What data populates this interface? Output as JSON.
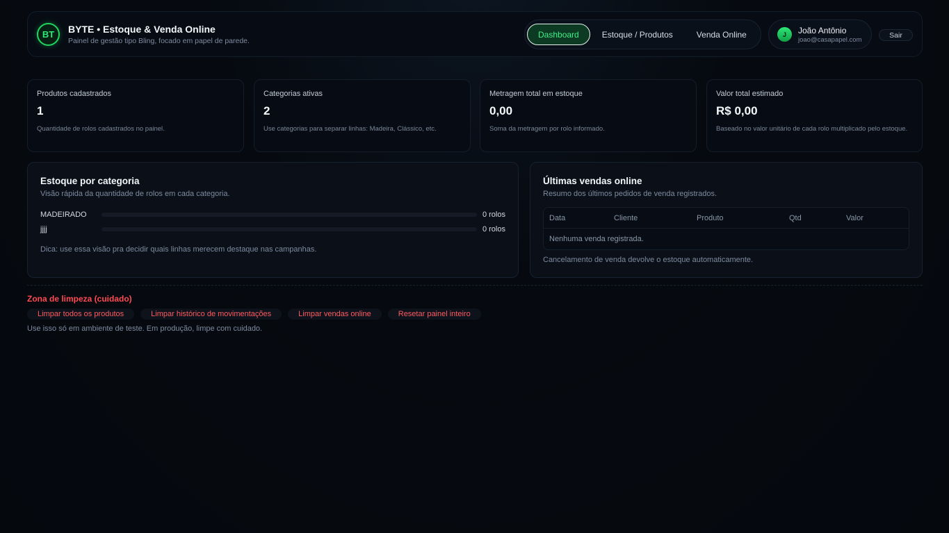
{
  "header": {
    "logo_text": "BT",
    "title": "BYTE • Estoque & Venda Online",
    "subtitle": "Painel de gestão tipo Bling, focado em papel de parede.",
    "nav": [
      "Dashboard",
      "Estoque / Produtos",
      "Venda Online"
    ],
    "active_nav": "Dashboard",
    "user": {
      "initial": "J",
      "name": "João Antônio",
      "email": "joao@casapapel.com"
    },
    "logout_label": "Sair"
  },
  "stats": [
    {
      "label": "Produtos cadastrados",
      "value": "1",
      "desc": "Quantidade de rolos cadastrados no painel."
    },
    {
      "label": "Categorias ativas",
      "value": "2",
      "desc": "Use categorias para separar linhas: Madeira, Clássico, etc."
    },
    {
      "label": "Metragem total em estoque",
      "value": "0,00",
      "desc": "Soma da metragem por rolo informado."
    },
    {
      "label": "Valor total estimado",
      "value": "R$ 0,00",
      "desc": "Baseado no valor unitário de cada rolo multiplicado pelo estoque."
    }
  ],
  "stock_by_category": {
    "title": "Estoque por categoria",
    "subtitle": "Visão rápida da quantidade de rolos em cada categoria.",
    "rows": [
      {
        "name": "MADEIRADO",
        "count": "0 rolos",
        "fill": 0
      },
      {
        "name": "jjjj",
        "count": "0 rolos",
        "fill": 0
      }
    ],
    "tip": "Dica: use essa visão pra decidir quais linhas merecem destaque nas campanhas."
  },
  "recent_sales": {
    "title": "Últimas vendas online",
    "subtitle": "Resumo dos últimos pedidos de venda registrados.",
    "columns": [
      "Data",
      "Cliente",
      "Produto",
      "Qtd",
      "Valor"
    ],
    "empty": "Nenhuma venda registrada.",
    "note": "Cancelamento de venda devolve o estoque automaticamente."
  },
  "danger_zone": {
    "title": "Zona de limpeza (cuidado)",
    "buttons": [
      "Limpar todos os produtos",
      "Limpar histórico de movimentações",
      "Limpar vendas online",
      "Resetar painel inteiro"
    ],
    "note": "Use isso só em ambiente de teste. Em produção, limpe com cuidado."
  },
  "colors": {
    "accent": "#1fd65f",
    "danger": "#ff4a52",
    "background": "#05080e"
  }
}
